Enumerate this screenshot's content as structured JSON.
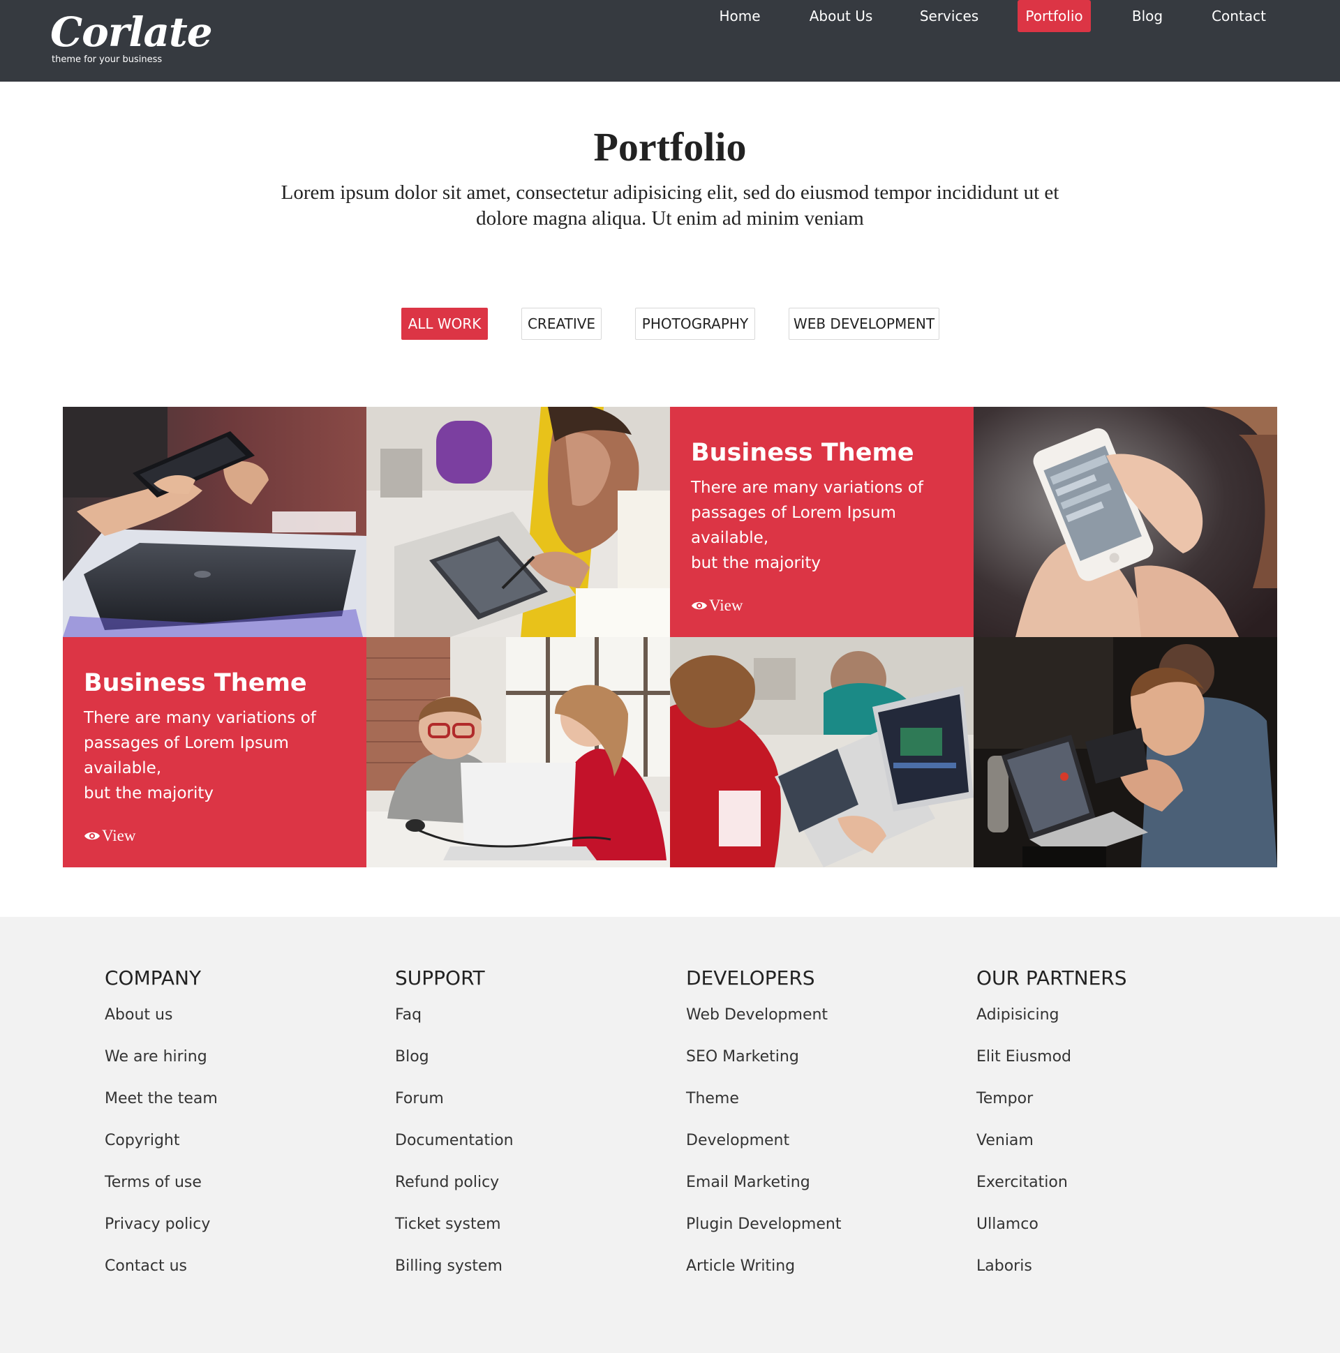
{
  "brand": {
    "logo_text": "Corlate",
    "tagline": "theme for your business"
  },
  "nav": {
    "items": [
      {
        "label": "Home"
      },
      {
        "label": "About Us"
      },
      {
        "label": "Services"
      },
      {
        "label": "Portfolio",
        "active": true
      },
      {
        "label": "Blog"
      },
      {
        "label": "Contact"
      }
    ]
  },
  "header": {
    "title": "Portfolio",
    "subtitle_line1": "Lorem ipsum dolor sit amet, consectetur adipisicing elit, sed do eiusmod tempor incididunt ut et",
    "subtitle_line2": "dolore magna aliqua. Ut enim ad minim veniam"
  },
  "filters": [
    {
      "label": "ALL WORK",
      "active": true
    },
    {
      "label": "CREATIVE"
    },
    {
      "label": "PHOTOGRAPHY"
    },
    {
      "label": "WEB DEVELOPMENT"
    }
  ],
  "cards": [
    {
      "title": "Business Theme",
      "line1": "There are many variations of",
      "line2": "passages of Lorem Ipsum available,",
      "line3": "but the majority",
      "view_label": "View"
    },
    {
      "title": "Business Theme",
      "line1": "There are many variations of",
      "line2": "passages of Lorem Ipsum available,",
      "line3": "but the majority",
      "view_label": "View"
    }
  ],
  "photos": [
    {
      "name": "photo-hands-phone-laptop"
    },
    {
      "name": "photo-man-drawing-tablet"
    },
    {
      "name": "photo-hands-smartphone"
    },
    {
      "name": "photo-kids-laptop"
    },
    {
      "name": "photo-boy-coding-laptops"
    },
    {
      "name": "photo-man-laptop-event"
    }
  ],
  "footer": {
    "columns": [
      {
        "heading": "COMPANY",
        "links": [
          "About us",
          "We are hiring",
          "Meet the team",
          "Copyright",
          "Terms of use",
          "Privacy policy",
          "Contact us"
        ]
      },
      {
        "heading": "SUPPORT",
        "links": [
          "Faq",
          "Blog",
          "Forum",
          "Documentation",
          "Refund policy",
          "Ticket system",
          "Billing system"
        ]
      },
      {
        "heading": "DEVELOPERS",
        "links": [
          "Web Development",
          "SEO Marketing",
          "Theme",
          "Development",
          "Email Marketing",
          "Plugin Development",
          "Article Writing"
        ]
      },
      {
        "heading": "OUR PARTNERS",
        "links": [
          "Adipisicing",
          "Elit Eiusmod",
          "Tempor",
          "Veniam",
          "Exercitation",
          "Ullamco",
          "Laboris"
        ]
      }
    ]
  },
  "colors": {
    "accent": "#dc3545",
    "navbar": "#363a40",
    "footer_bg": "#f2f2f2"
  }
}
